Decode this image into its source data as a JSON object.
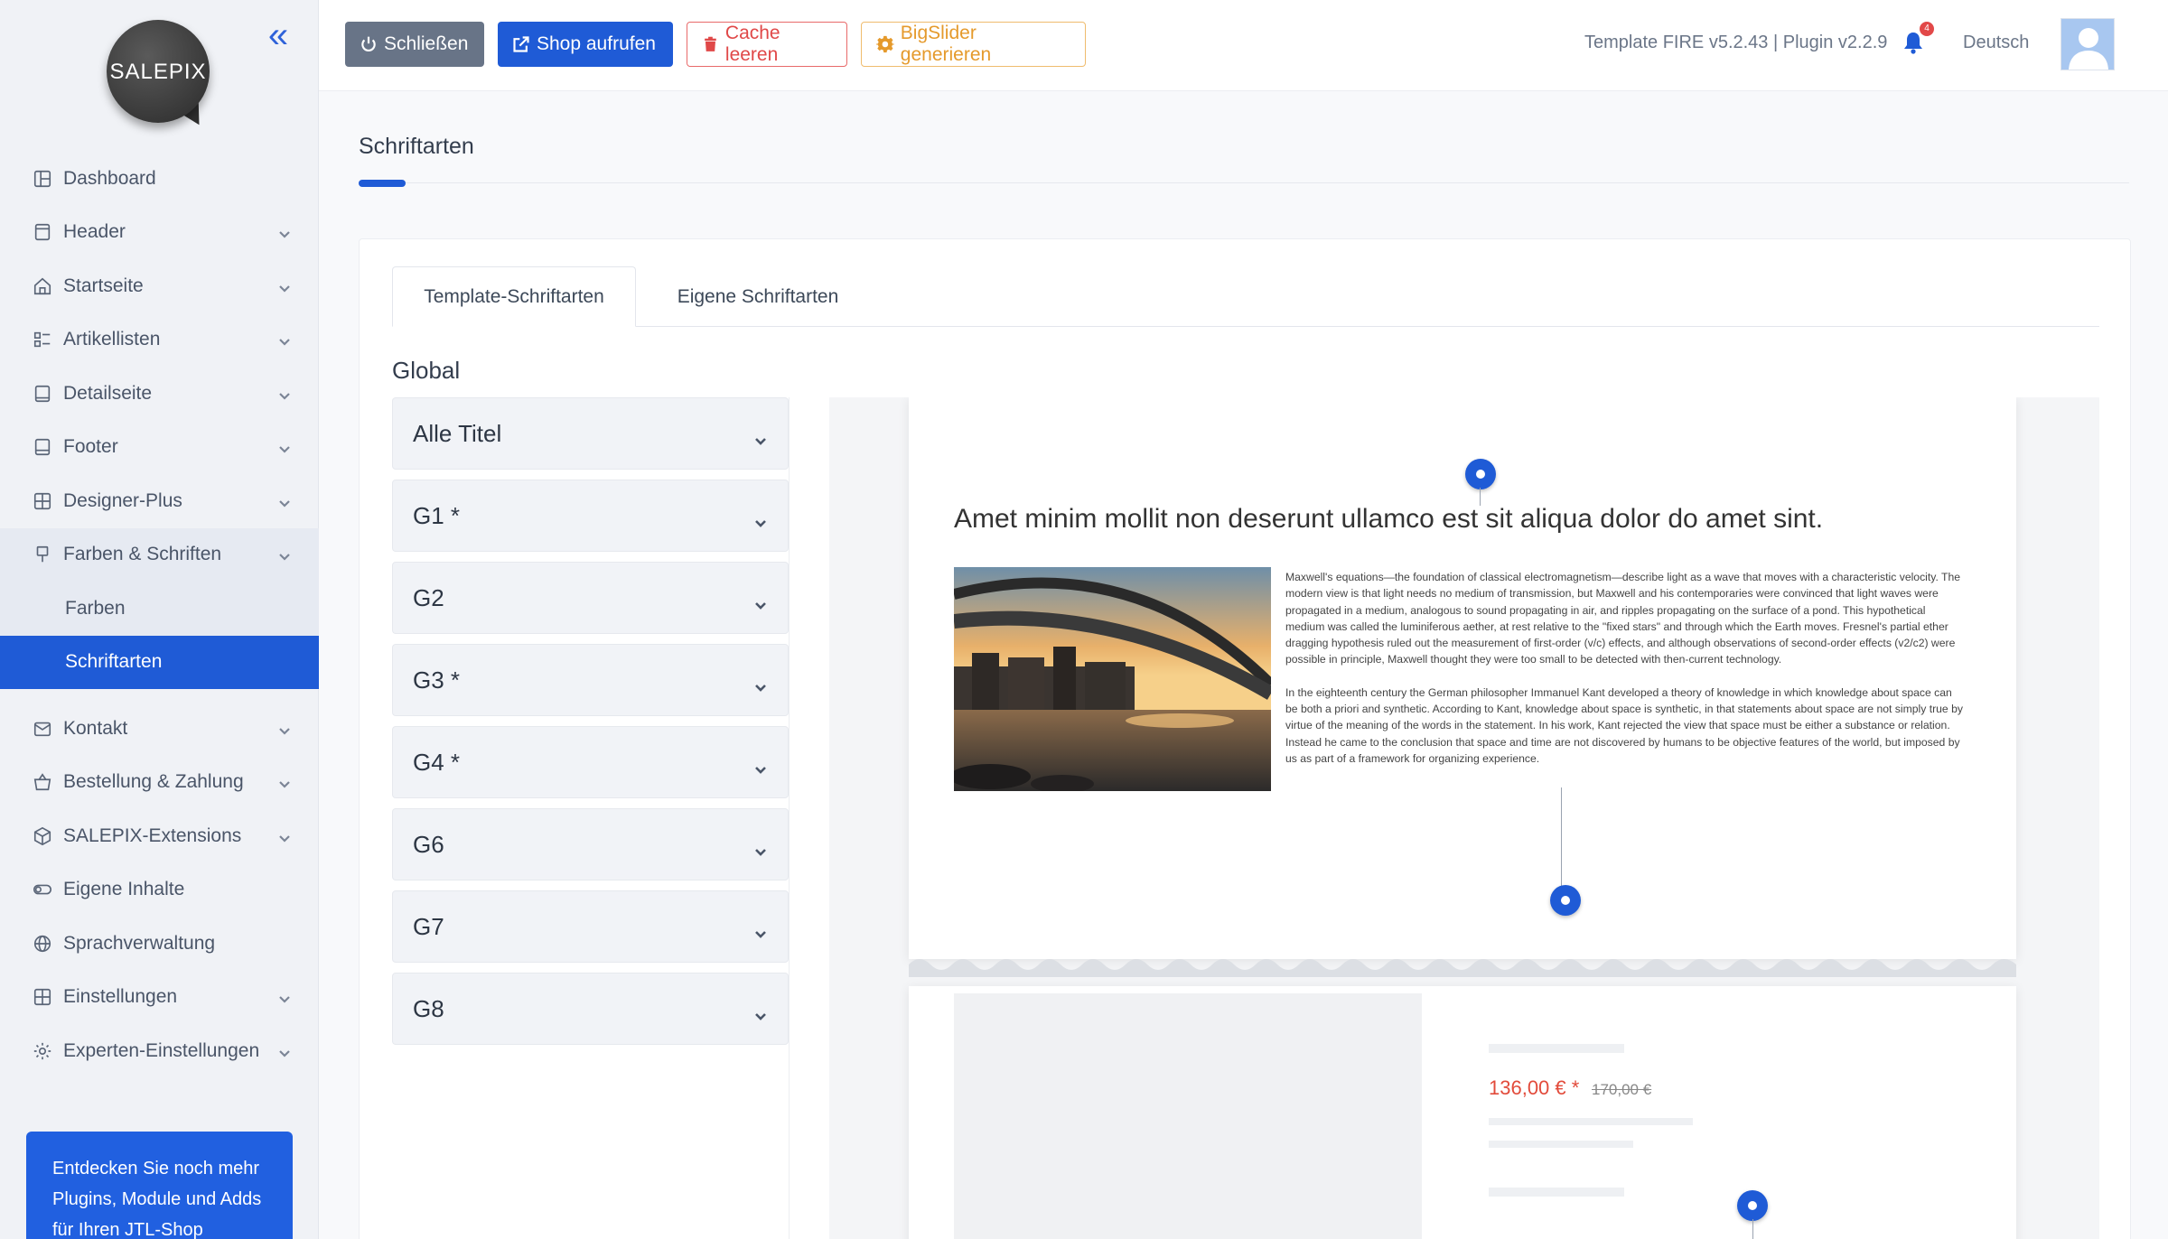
{
  "logo": {
    "text": "SALEPIX"
  },
  "sidebar": {
    "items": [
      {
        "label": "Dashboard",
        "icon": "dashboard-icon",
        "expandable": false
      },
      {
        "label": "Header",
        "icon": "header-icon",
        "expandable": true
      },
      {
        "label": "Startseite",
        "icon": "home-icon",
        "expandable": true
      },
      {
        "label": "Artikellisten",
        "icon": "list-icon",
        "expandable": true
      },
      {
        "label": "Detailseite",
        "icon": "detail-icon",
        "expandable": true
      },
      {
        "label": "Footer",
        "icon": "footer-icon",
        "expandable": true
      },
      {
        "label": "Designer-Plus",
        "icon": "designer-icon",
        "expandable": true
      },
      {
        "label": "Farben & Schriften",
        "icon": "brush-icon",
        "expandable": true,
        "open": true,
        "children": [
          {
            "label": "Farben"
          },
          {
            "label": "Schriftarten",
            "active": true
          }
        ]
      },
      {
        "label": "Kontakt",
        "icon": "contact-icon",
        "expandable": true
      },
      {
        "label": "Bestellung & Zahlung",
        "icon": "basket-icon",
        "expandable": true
      },
      {
        "label": "SALEPIX-Extensions",
        "icon": "box-icon",
        "expandable": true
      },
      {
        "label": "Eigene Inhalte",
        "icon": "toggle-icon",
        "expandable": false
      },
      {
        "label": "Sprachverwaltung",
        "icon": "globe-icon",
        "expandable": false
      },
      {
        "label": "Einstellungen",
        "icon": "grid-icon",
        "expandable": true
      },
      {
        "label": "Experten-Einstellungen",
        "icon": "gear-icon",
        "expandable": true
      }
    ],
    "promo": "Entdecken Sie noch mehr Plugins, Module und Adds für Ihren JTL-Shop"
  },
  "topbar": {
    "close_label": "Schließen",
    "shop_label": "Shop aufrufen",
    "cache_label": "Cache leeren",
    "slider_label": "BigSlider generieren",
    "version": "Template FIRE v5.2.43 | Plugin v2.2.9",
    "notification_count": "4",
    "language": "Deutsch"
  },
  "colors": {
    "primary": "#1f5bd6",
    "danger": "#e04848",
    "warning": "#e59a2c",
    "secondary": "#687487"
  },
  "page": {
    "title": "Schriftarten"
  },
  "tabs": [
    {
      "label": "Template-Schriftarten",
      "active": true
    },
    {
      "label": "Eigene Schriftarten",
      "active": false
    }
  ],
  "section": {
    "title": "Global"
  },
  "accordion": [
    "Alle Titel",
    "G1 *",
    "G2",
    "G3 *",
    "G4 *",
    "G6",
    "G7",
    "G8"
  ],
  "preview": {
    "heading": "Amet minim mollit non deserunt ullamco est sit aliqua dolor do amet sint.",
    "paragraph1": "Maxwell's equations—the foundation of classical electromagnetism—describe light as a wave that moves with a characteristic velocity. The modern view is that light needs no medium of transmission, but Maxwell and his contemporaries were convinced that light waves were propagated in a medium, analogous to sound propagating in air, and ripples propagating on the surface of a pond. This hypothetical medium was called the luminiferous aether, at rest relative to the \"fixed stars\" and through which the Earth moves. Fresnel's partial ether dragging hypothesis ruled out the measurement of first-order (v/c) effects, and although observations of second-order effects (v2/c2) were possible in principle, Maxwell thought they were too small to be detected with then-current technology.",
    "paragraph2": "In the eighteenth century the German philosopher Immanuel Kant developed a theory of knowledge in which knowledge about space can be both a priori and synthetic. According to Kant, knowledge about space is synthetic, in that statements about space are not simply true by virtue of the meaning of the words in the statement. In his work, Kant rejected the view that space must be either a substance or relation. Instead he came to the conclusion that space and time are not discovered by humans to be objective features of the world, but imposed by us as part of a framework for organizing experience.",
    "price": "136,00 € *",
    "price_old": "170,00 €"
  }
}
